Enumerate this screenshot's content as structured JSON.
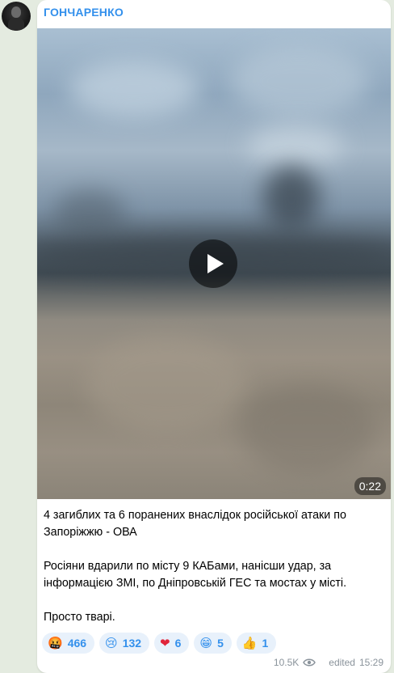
{
  "channel": {
    "name": "ГОНЧАРЕНКО"
  },
  "video": {
    "duration": "0:22"
  },
  "message": {
    "paragraphs": [
      "4 загиблих та 6 поранених внаслідок російської атаки по Запоріжжю - ОВА",
      "Росіяни вдарили по місту 9 КАБами, нанісши удар, за інформацією ЗМІ, по Дніпровській ГЕС та мостах у місті.",
      "Просто тварі."
    ]
  },
  "reactions": [
    {
      "emoji": "🤬",
      "icon": "angry-face-icon",
      "count": "466"
    },
    {
      "emoji": "😢",
      "icon": "crying-face-icon",
      "count": "132"
    },
    {
      "emoji": "❤",
      "icon": "heart-icon",
      "count": "6",
      "color": "#e0243a"
    },
    {
      "emoji": "😁",
      "icon": "grinning-face-icon",
      "count": "5"
    },
    {
      "emoji": "👍",
      "icon": "thumbs-up-icon",
      "count": "1"
    }
  ],
  "meta": {
    "views": "10.5K",
    "edited_label": "edited",
    "time": "15:29"
  },
  "colors": {
    "accent": "#3390ec",
    "background": "#e4ebe0",
    "meta_text": "#8a939b"
  }
}
